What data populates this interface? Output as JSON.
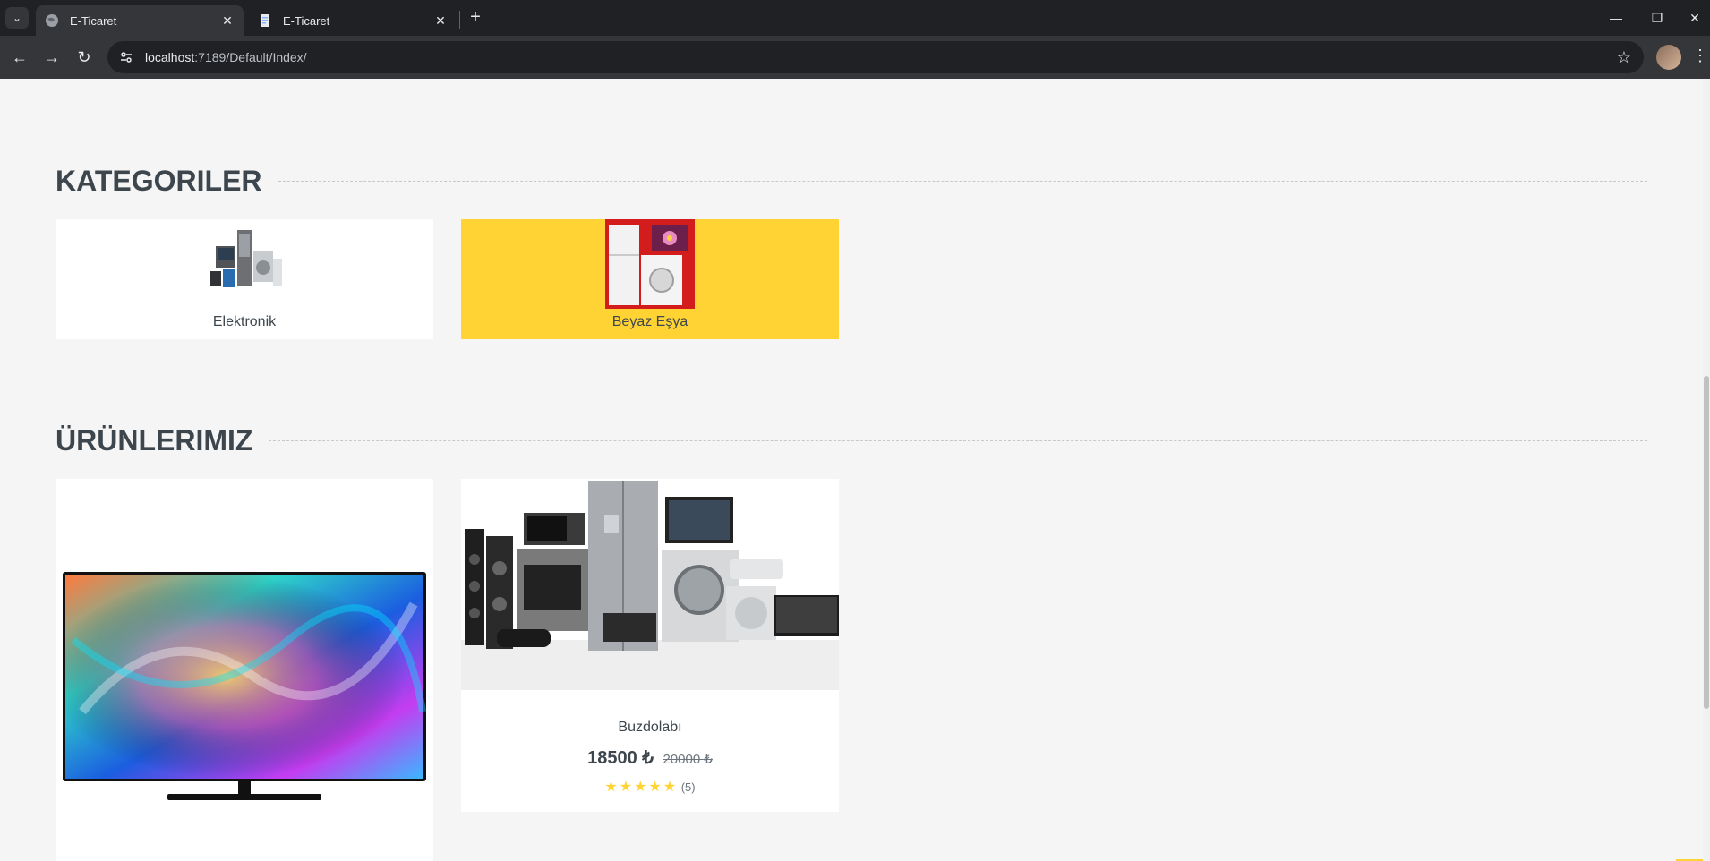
{
  "browser": {
    "tabs": [
      {
        "title": "E-Ticaret",
        "active": true
      },
      {
        "title": "E-Ticaret",
        "active": false
      }
    ],
    "url_host": "localhost",
    "url_rest": ":7189/Default/Index/"
  },
  "colors": {
    "accent": "#ffd333",
    "heading": "#3d464d",
    "page_bg": "#f5f5f5"
  },
  "categories": {
    "heading": "KATEGORILER",
    "items": [
      {
        "name": "Elektronik",
        "icon": "appliances-image",
        "highlighted": false
      },
      {
        "name": "Beyaz Eşya",
        "icon": "white-goods-image",
        "highlighted": true
      }
    ]
  },
  "products": {
    "heading": "ÜRÜNLERIMIZ",
    "items": [
      {
        "image": "tv-image"
      },
      {
        "name": "Buzdolabı",
        "price": "18500 ₺",
        "old_price": "20000 ₺",
        "stars": "★★★★★",
        "review_count": "(5)",
        "image": "appliances-group-image"
      }
    ]
  }
}
